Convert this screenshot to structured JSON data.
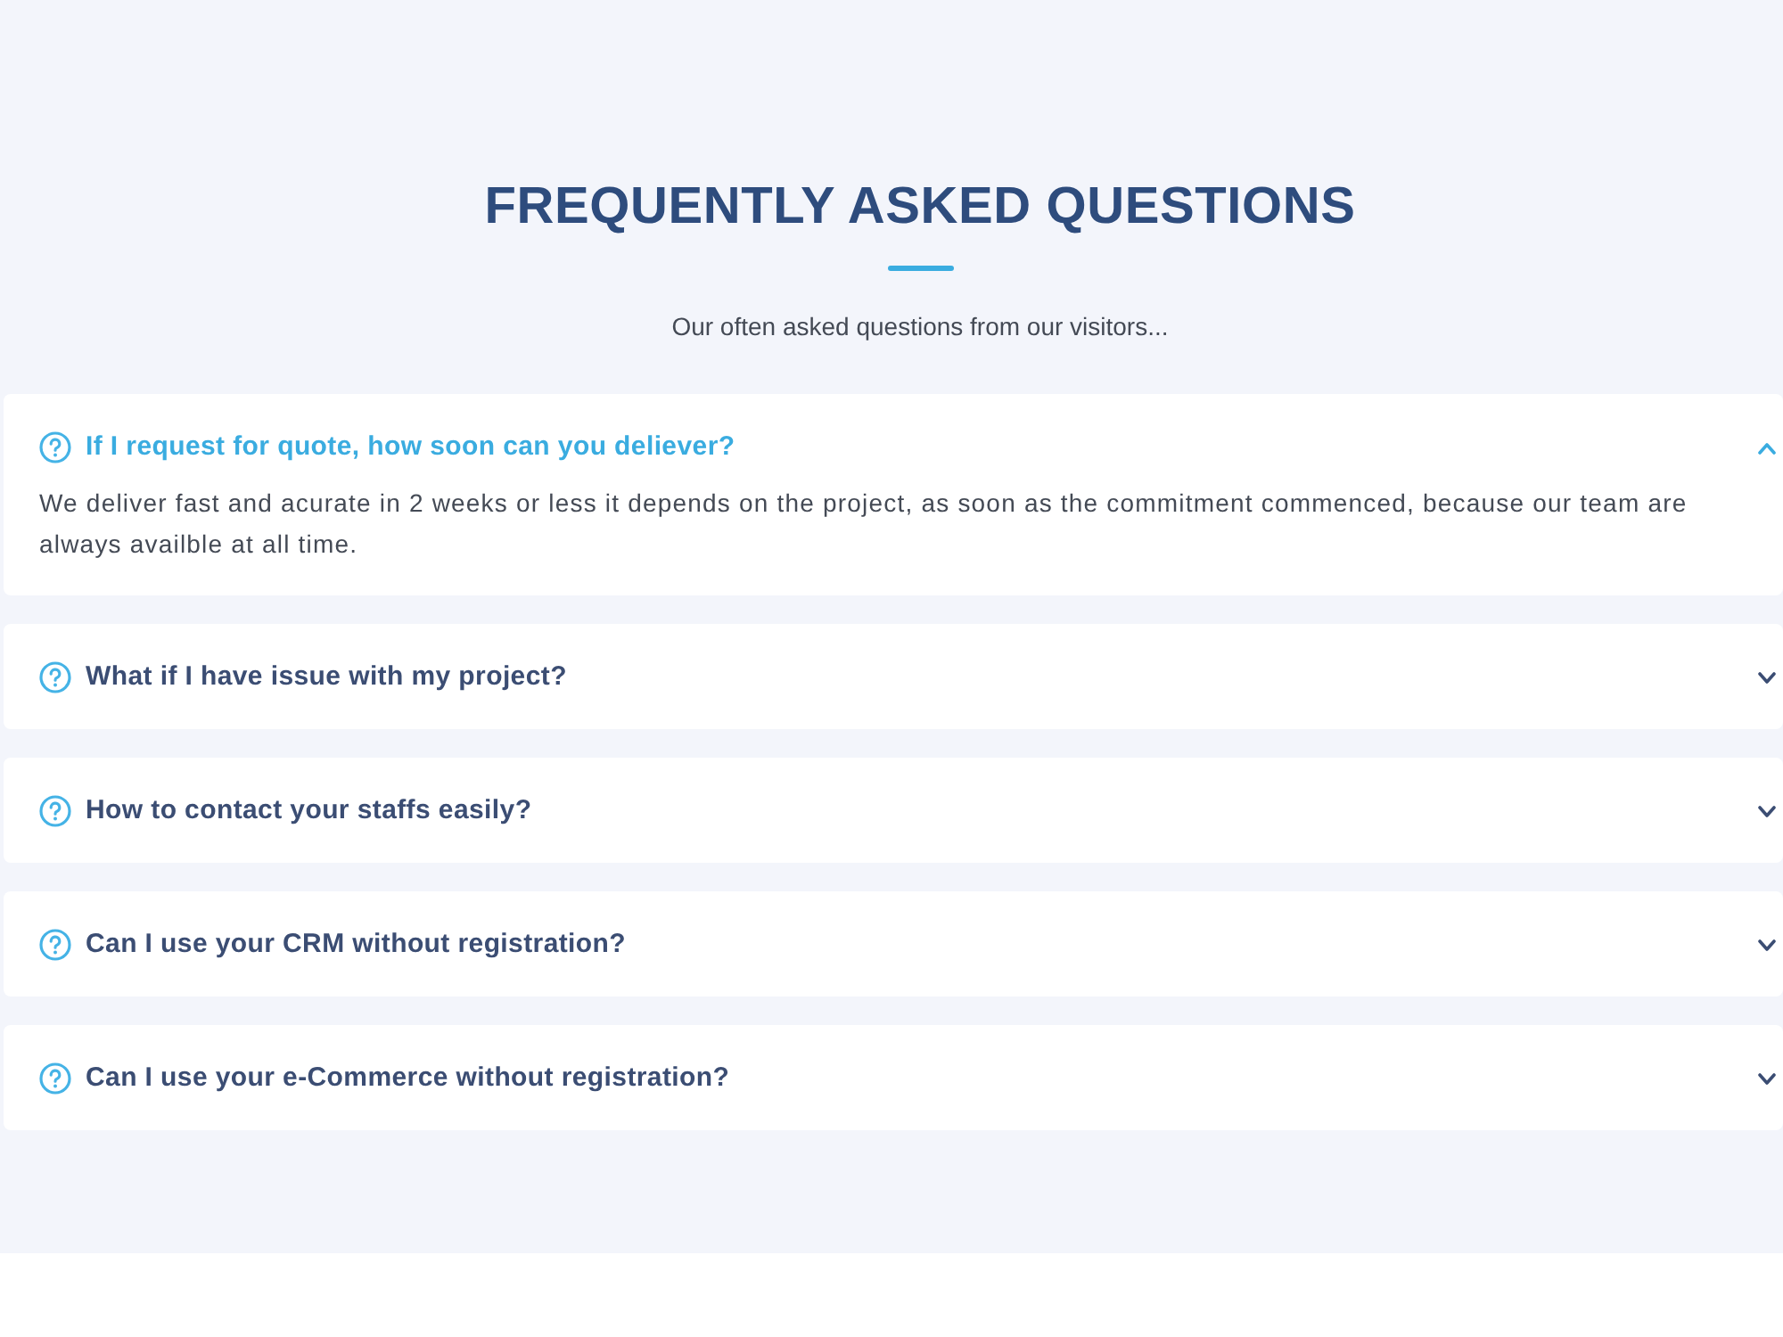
{
  "header": {
    "title": "FREQUENTLY ASKED QUESTIONS",
    "subtitle": "Our often asked questions from our visitors..."
  },
  "faqs": [
    {
      "question": "If I request for quote, how soon can you deliever?",
      "expanded": true,
      "answer": "We deliver fast and acurate in 2 weeks or less it depends on the project, as soon as the commitment commenced, because our team are always availble at all time."
    },
    {
      "question": "What if I have issue with my project?",
      "expanded": false
    },
    {
      "question": "How to contact your staffs easily?",
      "expanded": false
    },
    {
      "question": "Can I use your CRM without registration?",
      "expanded": false
    },
    {
      "question": "Can I use your e-Commerce without registration?",
      "expanded": false
    }
  ]
}
